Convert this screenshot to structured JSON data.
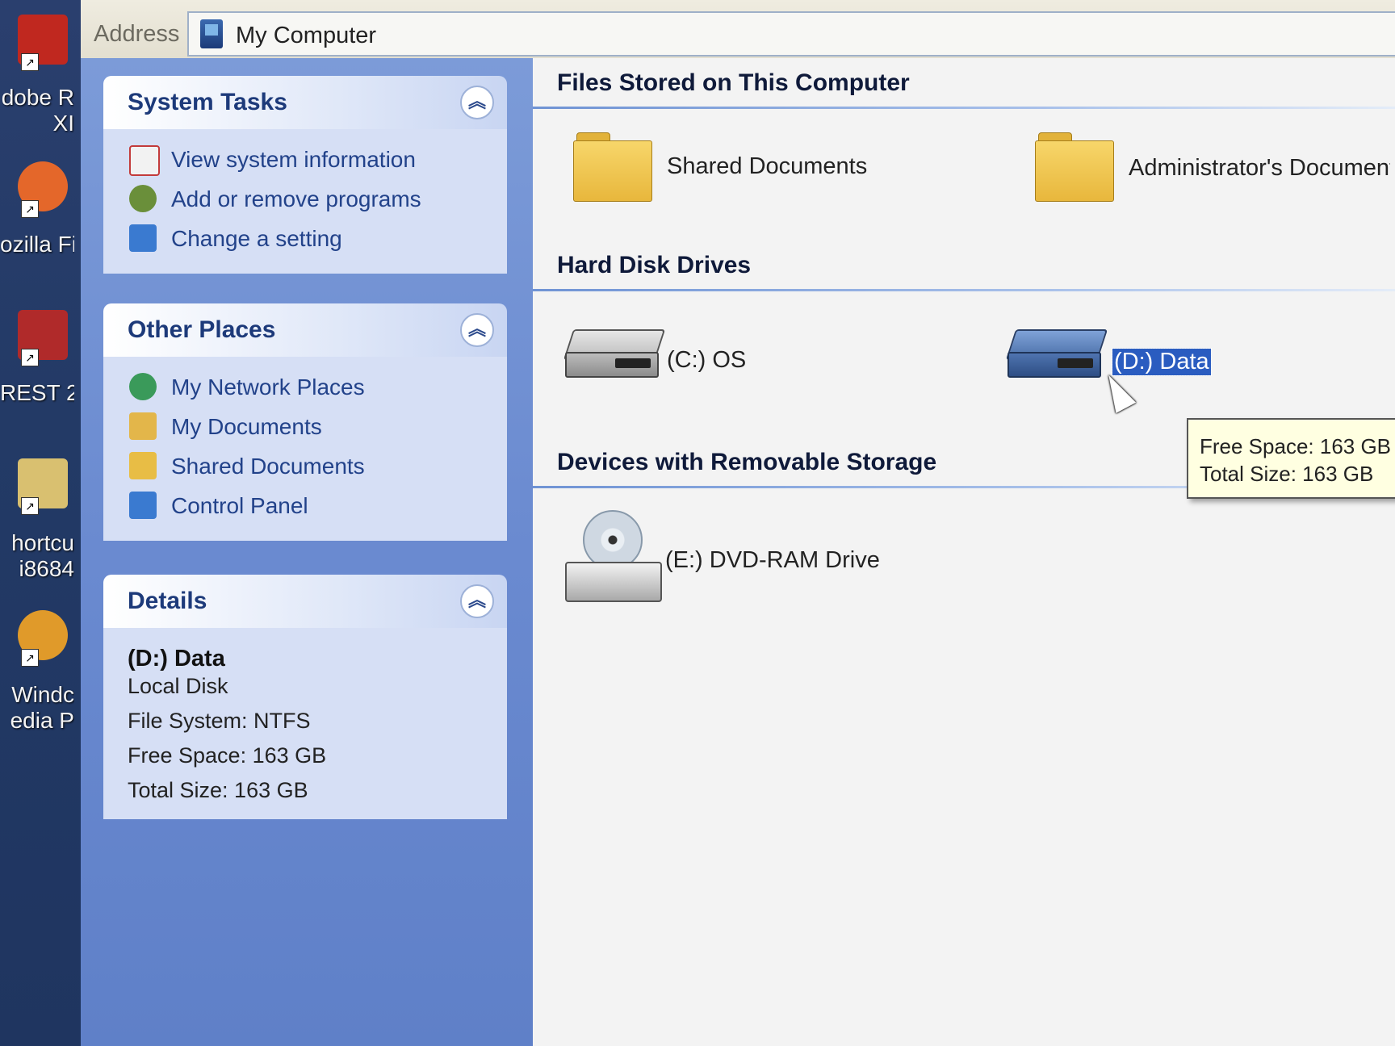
{
  "desktop": {
    "icons": [
      {
        "label": "dobe R",
        "label2": "XI",
        "color": "#c0281f",
        "icon": "adobe-reader-icon"
      },
      {
        "label": "ozilla Fi",
        "label2": "",
        "color": "#e4672a",
        "icon": "firefox-icon"
      },
      {
        "label": "REST 2",
        "label2": "",
        "color": "#b02a2a",
        "icon": "rest-icon"
      },
      {
        "label": "hortcu",
        "label2": "i8684",
        "color": "#d9c070",
        "icon": "shortcut-icon"
      },
      {
        "label": "Windc",
        "label2": "edia P",
        "color": "#e09a2a",
        "icon": "windows-media-player-icon"
      }
    ]
  },
  "address_bar": {
    "label": "Address",
    "value": "My Computer"
  },
  "task_pane": {
    "system_tasks": {
      "title": "System Tasks",
      "items": [
        {
          "label": "View system information",
          "icon": "system-info-icon",
          "color": "#c33b3b"
        },
        {
          "label": "Add or remove programs",
          "icon": "add-remove-programs-icon",
          "color": "#6a8f3a"
        },
        {
          "label": "Change a setting",
          "icon": "control-panel-icon",
          "color": "#3a7ad0"
        }
      ]
    },
    "other_places": {
      "title": "Other Places",
      "items": [
        {
          "label": "My Network Places",
          "icon": "network-places-icon",
          "color": "#3a9a5a"
        },
        {
          "label": "My Documents",
          "icon": "my-documents-icon",
          "color": "#e3b64a"
        },
        {
          "label": "Shared Documents",
          "icon": "folder-icon",
          "color": "#e8bd45"
        },
        {
          "label": "Control Panel",
          "icon": "control-panel-icon",
          "color": "#3a7ad0"
        }
      ]
    },
    "details": {
      "title": "Details",
      "name": "(D:) Data",
      "type": "Local Disk",
      "file_system": "File System: NTFS",
      "free_space": "Free Space: 163 GB",
      "total_size": "Total Size: 163 GB"
    }
  },
  "content": {
    "files_group": {
      "title": "Files Stored on This Computer",
      "items": [
        {
          "label": "Shared Documents"
        },
        {
          "label": "Administrator's Documents"
        }
      ]
    },
    "hdd_group": {
      "title": "Hard Disk Drives",
      "items": [
        {
          "label": "(C:) OS",
          "color": "#9a9a9a"
        },
        {
          "label": "(D:) Data",
          "color": "#4a6fa8"
        }
      ]
    },
    "removable_group": {
      "title": "Devices with Removable Storage",
      "items": [
        {
          "label": "(E:) DVD-RAM Drive"
        }
      ]
    }
  },
  "tooltip": {
    "line1": "Free Space: 163 GB",
    "line2": "Total Size: 163 GB"
  },
  "colors": {
    "taskpane_blue": "#6a8ad0",
    "selection": "#2a5cc0",
    "tooltip_bg": "#ffffe1"
  }
}
